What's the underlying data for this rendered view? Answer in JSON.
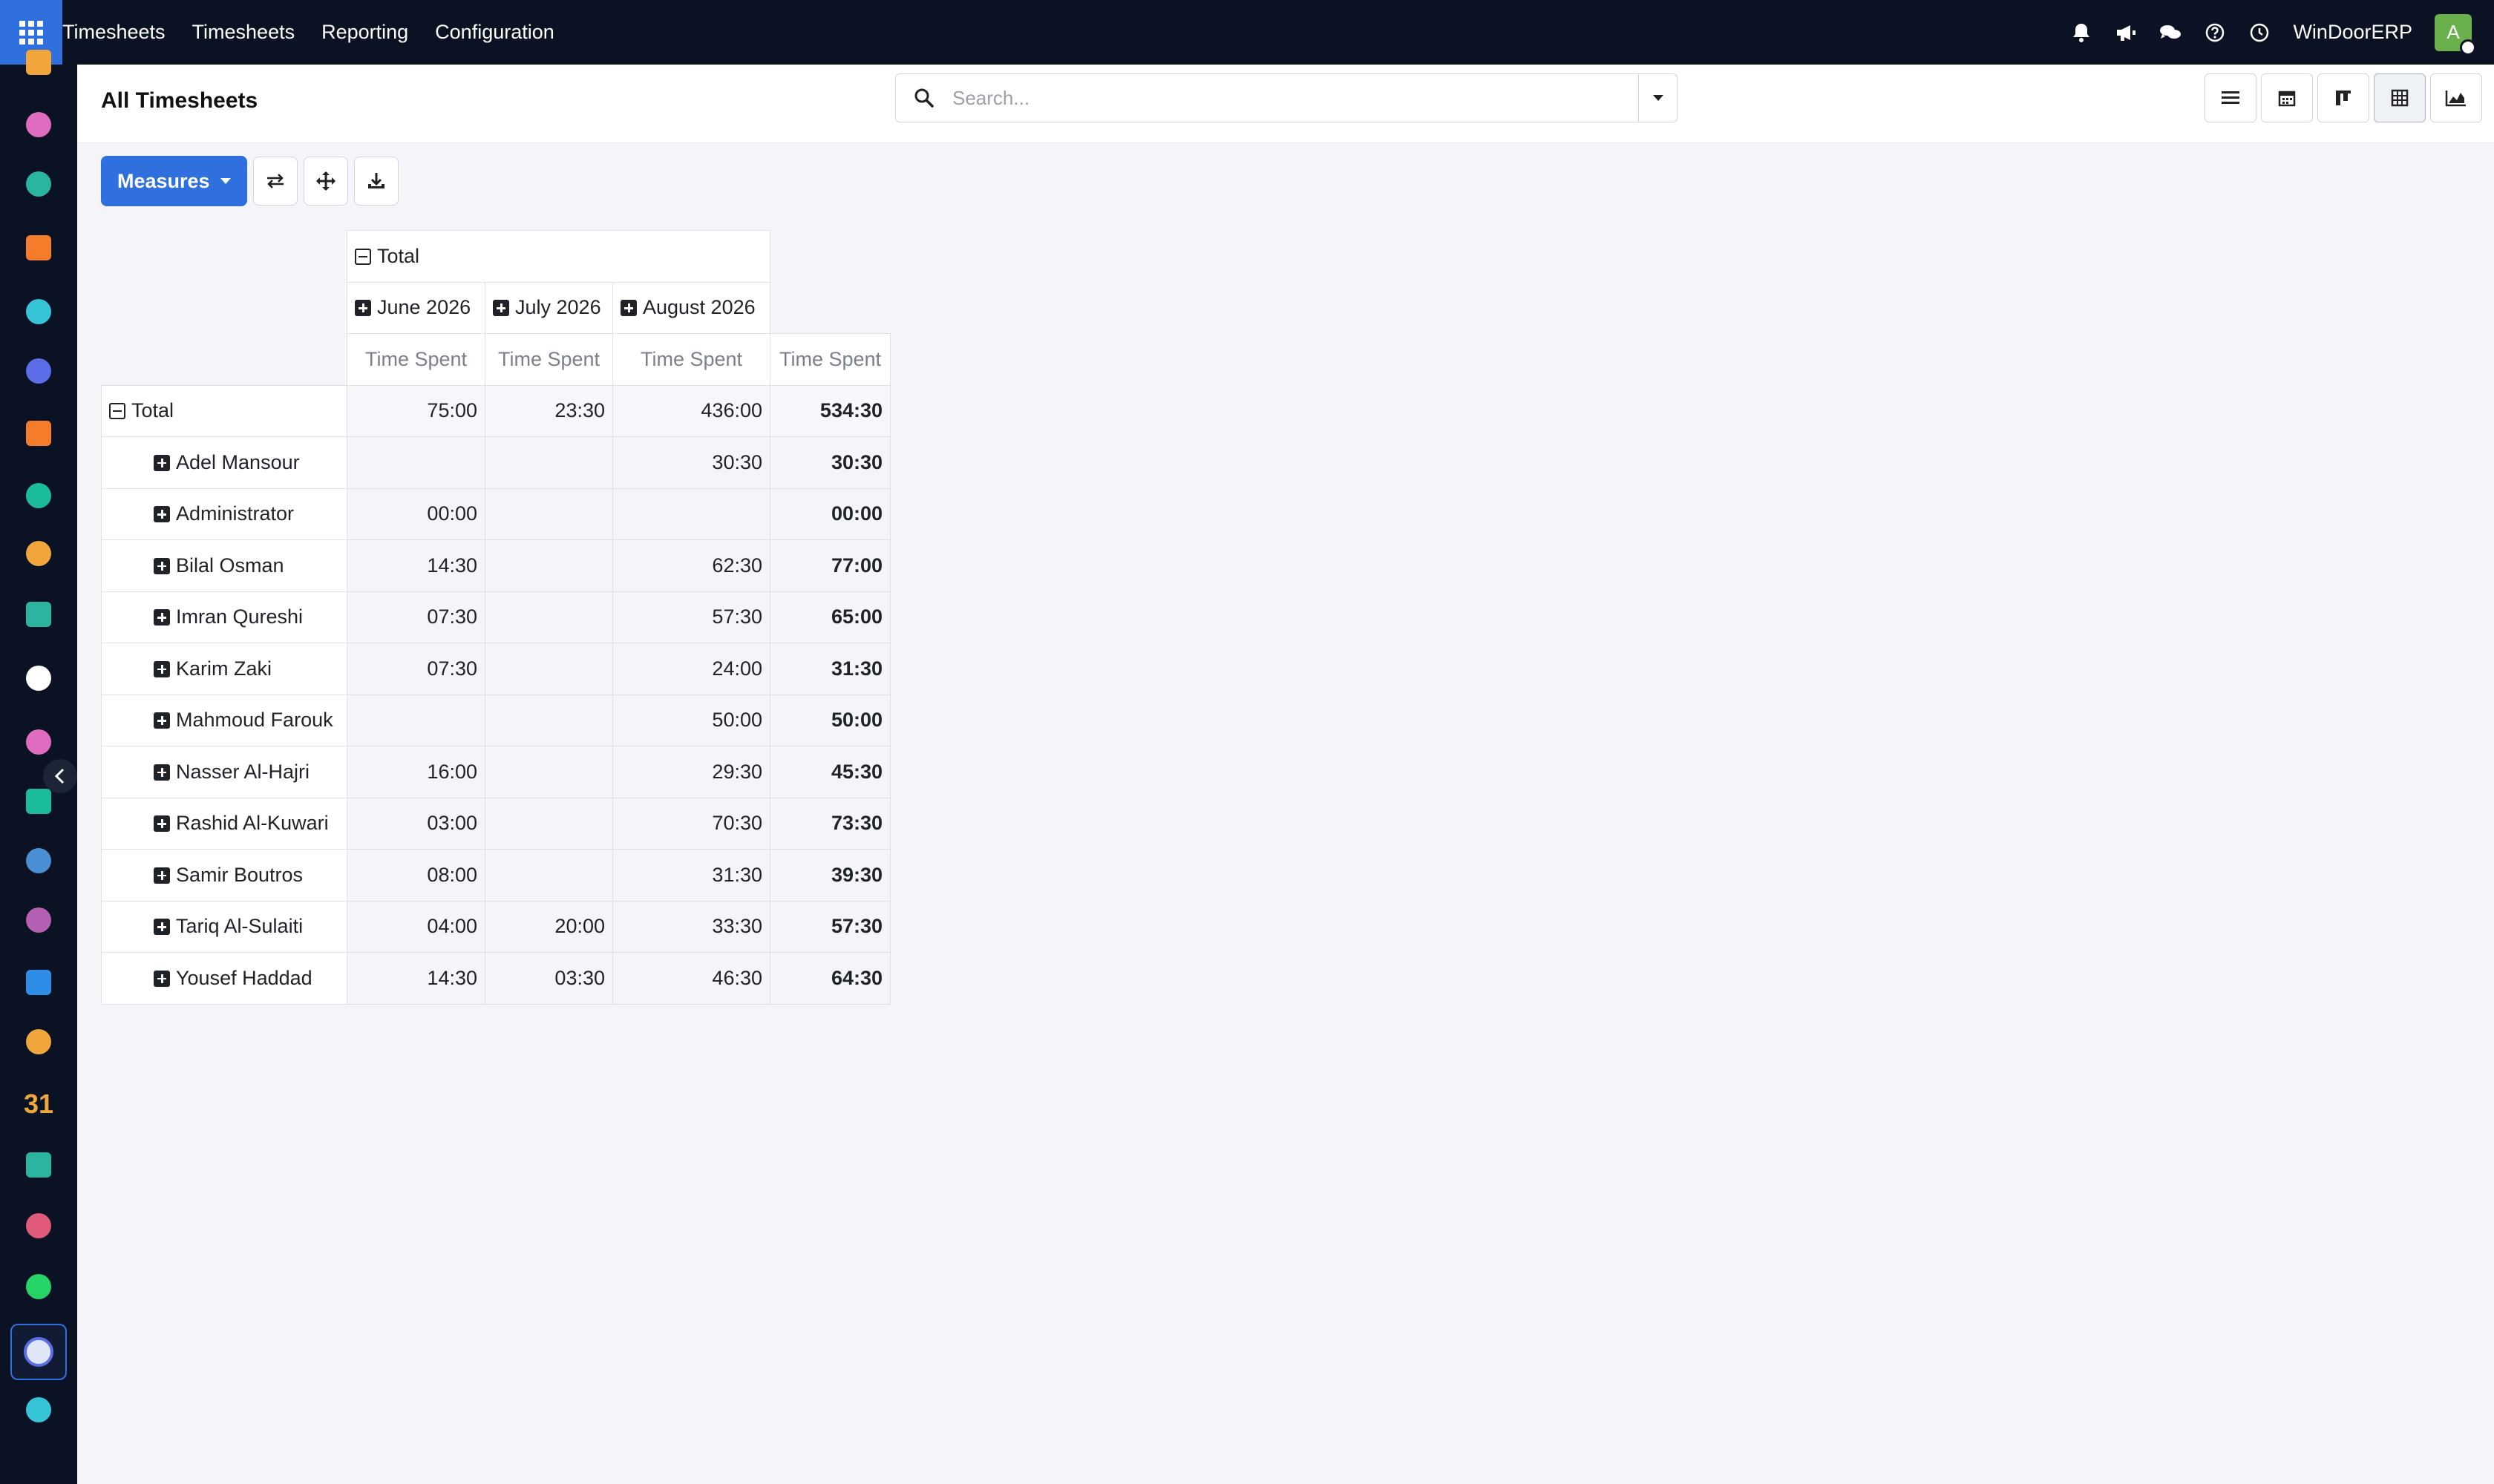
{
  "navbar": {
    "menu": [
      "Timesheets",
      "Timesheets",
      "Reporting",
      "Configuration"
    ],
    "company": "WinDoorERP",
    "avatar_letter": "A",
    "icons": [
      "bell-icon",
      "megaphone-icon",
      "chat-icon",
      "help-icon",
      "clock-icon"
    ]
  },
  "sidebar": {
    "apps": [
      {
        "icon": "dashboard-app-icon",
        "color": "#f0a63a"
      },
      {
        "icon": "calendar-app-icon",
        "color": "#e06cc2"
      },
      {
        "icon": "contacts-app-icon",
        "color": "#2bb5a0"
      },
      {
        "icon": "discuss-app-icon",
        "color": "#f47c2b"
      },
      {
        "icon": "helpdesk-app-icon",
        "color": "#35c3d6"
      },
      {
        "icon": "mail-app-icon",
        "color": "#5b6ee8"
      },
      {
        "icon": "livechat-app-icon",
        "color": "#f47c2b"
      },
      {
        "icon": "email-marketing-app-icon",
        "color": "#1bbc9b"
      },
      {
        "icon": "reporting-app-icon",
        "color": "#f0a63a"
      },
      {
        "icon": "employees-app-icon",
        "color": "#2bb5a0"
      },
      {
        "icon": "inventory-app-icon",
        "color": "#ffffff"
      },
      {
        "icon": "sales-app-icon",
        "color": "#e06cc2"
      },
      {
        "icon": "project-app-icon",
        "color": "#1bbc9b"
      },
      {
        "icon": "knowledge-app-icon",
        "color": "#4a8fd6"
      },
      {
        "icon": "purchase-app-icon",
        "color": "#b45fb2"
      },
      {
        "icon": "invoicing-app-icon",
        "color": "#2e8de6"
      },
      {
        "icon": "team-app-icon",
        "color": "#f0a63a"
      },
      {
        "icon": "calendar-31-app-icon",
        "color": "#f0a63a"
      },
      {
        "icon": "sign-app-icon",
        "color": "#2bb5a0"
      },
      {
        "icon": "apps-app-icon",
        "color": "#e05a7a"
      },
      {
        "icon": "whatsapp-app-icon",
        "color": "#25d366"
      },
      {
        "icon": "timesheets-app-icon",
        "color": "#5b6ee8"
      },
      {
        "icon": "helpdesk2-app-icon",
        "color": "#35c3d6"
      }
    ],
    "calendar_label": "31"
  },
  "control": {
    "title": "All Timesheets",
    "search_placeholder": "Search...",
    "views": [
      "list-view-icon",
      "calendar-view-icon",
      "kanban-view-icon",
      "pivot-view-icon",
      "graph-view-icon"
    ]
  },
  "toolbar": {
    "measures_label": "Measures"
  },
  "pivot": {
    "col_total": "Total",
    "months": [
      "June 2026",
      "July 2026",
      "August 2026"
    ],
    "measure": "Time Spent",
    "row_total": "Total",
    "total_row": [
      "75:00",
      "23:30",
      "436:00",
      "534:30"
    ],
    "rows": [
      {
        "name": "Adel Mansour",
        "values": [
          "",
          "",
          "30:30",
          "30:30"
        ]
      },
      {
        "name": "Administrator",
        "values": [
          "00:00",
          "",
          "",
          "00:00"
        ]
      },
      {
        "name": "Bilal Osman",
        "values": [
          "14:30",
          "",
          "62:30",
          "77:00"
        ]
      },
      {
        "name": "Imran Qureshi",
        "values": [
          "07:30",
          "",
          "57:30",
          "65:00"
        ]
      },
      {
        "name": "Karim Zaki",
        "values": [
          "07:30",
          "",
          "24:00",
          "31:30"
        ]
      },
      {
        "name": "Mahmoud Farouk",
        "values": [
          "",
          "",
          "50:00",
          "50:00"
        ]
      },
      {
        "name": "Nasser Al-Hajri",
        "values": [
          "16:00",
          "",
          "29:30",
          "45:30"
        ]
      },
      {
        "name": "Rashid Al-Kuwari",
        "values": [
          "03:00",
          "",
          "70:30",
          "73:30"
        ]
      },
      {
        "name": "Samir Boutros",
        "values": [
          "08:00",
          "",
          "31:30",
          "39:30"
        ]
      },
      {
        "name": "Tariq Al-Sulaiti",
        "values": [
          "04:00",
          "20:00",
          "33:30",
          "57:30"
        ]
      },
      {
        "name": "Yousef Haddad",
        "values": [
          "14:30",
          "03:30",
          "46:30",
          "64:30"
        ]
      }
    ]
  },
  "colors": {
    "navbar_bg": "#0b1223",
    "accent": "#2f6fde",
    "page_bg": "#f3f5f9"
  }
}
